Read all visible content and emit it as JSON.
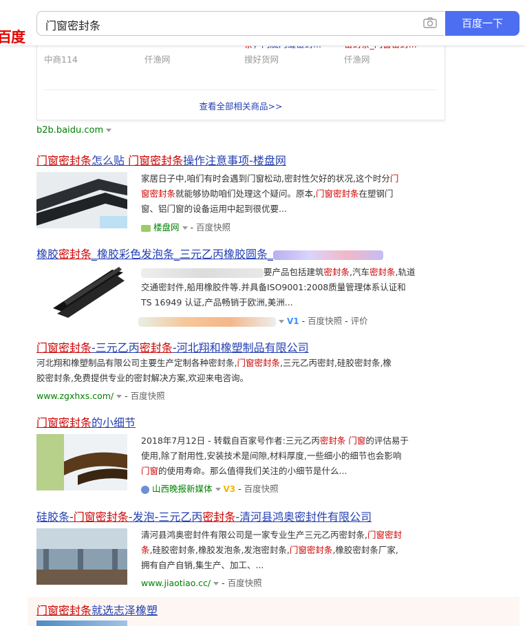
{
  "search": {
    "logo_text": "百度",
    "query": "门窗密封条",
    "button_label": "百度一下"
  },
  "products": [
    {
      "line1": "",
      "source": "中商114"
    },
    {
      "line1": "",
      "source": "仟渔网"
    },
    {
      "line1a": "条",
      "line1b": "，门底门缝密封...",
      "source": "搜好货网"
    },
    {
      "line1": "密封条_门窗密封...",
      "source": "仟渔网"
    }
  ],
  "view_all": "查看全部相关商品>>",
  "b2b_domain": "b2b.baidu.com",
  "results": [
    {
      "title_a": "门窗密封条",
      "title_b": "怎么贴 ",
      "title_c": "门窗密封条",
      "title_d": "操作注意事项-楼盘网",
      "desc_1": "家居日子中,咱们有时会遇到门窗松动,密封性欠好的状况,这个时分",
      "desc_1r": "门",
      "desc_2r": "窗密封条",
      "desc_2": "就能够协助咱们处理这个疑问。原本,",
      "desc_2r2": "门窗密封条",
      "desc_2b": "在塑钢门",
      "desc_3": "窗、铝门窗的设备运用中起到很优要...",
      "site": "楼盘网",
      "snapshot": "百度快照"
    },
    {
      "title_a": "橡胶",
      "title_b": "密封条",
      "title_c": "_橡胶彩色发泡条_三元乙丙橡胶圆条_",
      "desc_1": "要产品包括建筑",
      "desc_1r": "密封条",
      "desc_1b": ",汽车",
      "desc_1r2": "密封条",
      "desc_1c": ",轨道",
      "desc_2": "交通密封件,船用橡胶件等.并具备ISO9001:2008质量管理体系认证和",
      "desc_3": "TS 16949 认证,产品畅销于欧洲,美洲...",
      "badge": "V1",
      "snapshot": "百度快照",
      "review": "评价"
    },
    {
      "title_a": "门窗密封条",
      "title_b": "-三元乙丙",
      "title_c": "密封条",
      "title_d": "-河北翔和橡塑制品有限公司",
      "desc_1": "河北翔和橡塑制品有限公司主要生产定制各种密封条,",
      "desc_1r": "门窗密封条",
      "desc_1b": ",三元乙丙密封,硅胶密封条,橡",
      "desc_2": "胶密封条,免费提供专业的密封解决方案,欢迎来电咨询。",
      "site": "www.zgxhxs.com/",
      "snapshot": "百度快照"
    },
    {
      "title_a": "门窗密封条",
      "title_b": "的小细节",
      "desc_1": "2018年7月12日 - 转载自百家号作者:三元乙丙",
      "desc_1r": "密封条",
      "desc_1b": " ",
      "desc_1r2": "门窗",
      "desc_1c": "的评估易于",
      "desc_2": "使用,除了耐用性,安装技术是间隙,材料厚度,一些细小的细节也会影响",
      "desc_3r": "门窗",
      "desc_3": "的使用寿命。那么值得我们关注的小细节是什么...",
      "site": "山西晚报新媒体",
      "badge": "V3",
      "snapshot": "百度快照"
    },
    {
      "title_a": "硅胶条-",
      "title_b": "门窗密封条",
      "title_c": "-发泡-三元乙丙",
      "title_d": "密封条",
      "title_e": "-清河县鸿奥密封件有限公司",
      "desc_1": "清河县鸿奥密封件有限公司是一家专业生产三元乙丙密封条,",
      "desc_1r": "门窗密封",
      "desc_2r": "条",
      "desc_2": ",硅胶密封条,橡胶发泡条,发泡密封条,",
      "desc_2r2": "门窗密封条",
      "desc_2b": ",橡胶密封条厂家,",
      "desc_3": "拥有自产自销,集生产、加工、...",
      "site": "www.jiaotiao.cc/",
      "snapshot": "百度快照"
    },
    {
      "title_a": "门窗密封条",
      "title_b": "就选志泽橡塑"
    }
  ],
  "colors": {
    "link": "#2440b3",
    "highlight": "#c00",
    "site": "#008000",
    "button": "#4e6ef2"
  }
}
